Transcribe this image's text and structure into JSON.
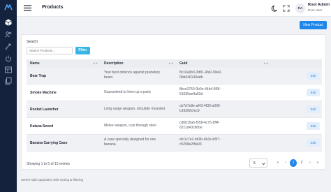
{
  "colors": {
    "sidebar_bg": "#15223e",
    "accent": "#1f86ea",
    "filter": "#37b6e6"
  },
  "sidebar": {
    "logo": "app-logo-icon",
    "items": [
      {
        "icon": "cube-icon"
      },
      {
        "icon": "users-icon"
      },
      {
        "icon": "rocket-icon"
      },
      {
        "icon": "power-icon"
      },
      {
        "icon": "table-icon"
      },
      {
        "icon": "copy-icon"
      }
    ]
  },
  "header": {
    "title": "Products",
    "theme_icon": "moon-icon",
    "fullscreen_icon": "fullscreen-icon",
    "avatar_initials": "RA",
    "user_name": "Root Admin",
    "user_role": "Root User"
  },
  "toolbar": {
    "new_product_label": "New Product"
  },
  "search": {
    "label": "Search:",
    "placeholder": "Search Products...",
    "value": "",
    "filter_label": "Filter"
  },
  "table": {
    "columns": [
      "Name",
      "Description",
      "Guid"
    ],
    "rows": [
      {
        "name": "Bear Trap",
        "desc1": "Your best defence against predatory",
        "desc2": "bears",
        "guid1": "8c16a0b3-3d81-4fa0-90e9-",
        "guid2": "0bb646140adb",
        "edit": "Edit"
      },
      {
        "name": "Smoke Machine",
        "desc1": "Guaranteed to liven up a party",
        "desc2": "",
        "guid1": "8bcc0750-0b0e-44b4-8f9f-",
        "guid2": "51595ae9a63d",
        "edit": "Edit"
      },
      {
        "name": "Rocket Launcher",
        "desc1": "Long range weapon, shoulder mounted",
        "desc2": "",
        "guid1": "cb7d7e8e-af43-4f30-a009-",
        "guid2": "b1fb2bfcfec9",
        "edit": "Edit"
      },
      {
        "name": "Katana Sword",
        "desc1": "Melee weapon, cuts through steel",
        "desc2": "",
        "guid1": "cd6615ab-f558-4c75-9ff4-",
        "guid2": "6211d43c80be",
        "edit": "Edit"
      },
      {
        "name": "Banana Carrying Case",
        "desc1": "A case specially designed for one",
        "desc2": "banana",
        "guid1": "efc1c7e2-b69b-4b3e-b5f7-",
        "guid2": "c5298e2f8a93",
        "edit": "Edit"
      }
    ]
  },
  "pagination": {
    "showing_text": "Showing 1 to 5 of 10 entries",
    "page_size": "5",
    "pages": [
      "«",
      "‹",
      "1",
      "2",
      "›",
      "»"
    ],
    "current": "1"
  },
  "footer_note": "Server-side pagination with sorting & filtering"
}
